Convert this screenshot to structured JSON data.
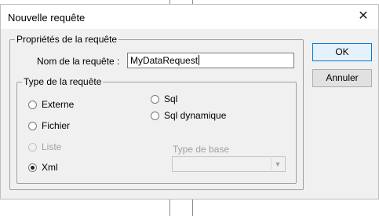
{
  "dialog": {
    "title": "Nouvelle requête",
    "close_icon": "close-icon"
  },
  "properties_group": {
    "legend": "Propriétés de la requête",
    "name_label": "Nom de la requête :",
    "name_value": "MyDataRequest"
  },
  "type_group": {
    "legend": "Type de la requête",
    "options": {
      "externe": "Externe",
      "fichier": "Fichier",
      "liste": "Liste",
      "xml": "Xml",
      "sql": "Sql",
      "sql_dynamique": "Sql dynamique"
    },
    "selected": "Xml",
    "base_type_label": "Type de base",
    "base_type_value": ""
  },
  "buttons": {
    "ok": "OK",
    "cancel": "Annuler"
  }
}
